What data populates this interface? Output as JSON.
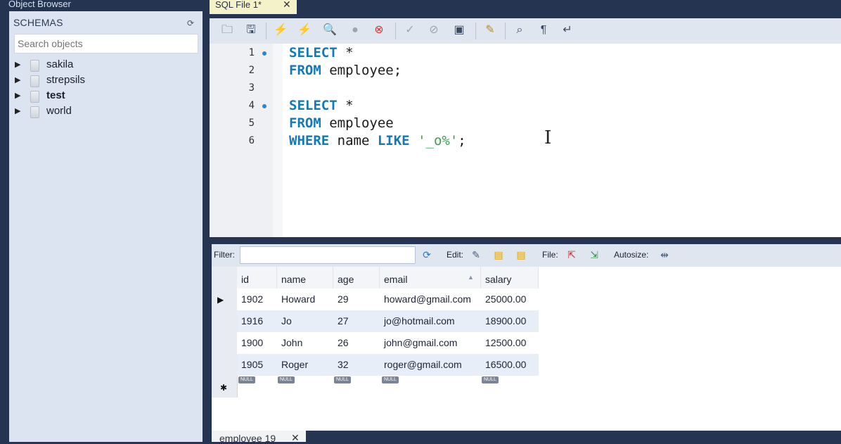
{
  "left_panel": {
    "title": "Object Browser",
    "schemas_header": "SCHEMAS",
    "search_placeholder": "Search objects",
    "schemas": [
      {
        "name": "sakila",
        "bold": false
      },
      {
        "name": "strepsils",
        "bold": false
      },
      {
        "name": "test",
        "bold": true
      },
      {
        "name": "world",
        "bold": false
      }
    ]
  },
  "editor_tab": {
    "label": "SQL File 1*",
    "close": "✕"
  },
  "editor": {
    "lines": [
      {
        "n": "1",
        "dot": true
      },
      {
        "n": "2",
        "dot": false
      },
      {
        "n": "3",
        "dot": false
      },
      {
        "n": "4",
        "dot": true
      },
      {
        "n": "5",
        "dot": false
      },
      {
        "n": "6",
        "dot": false
      }
    ],
    "code": {
      "l1_kw": "SELECT",
      "l1_rest": " *",
      "l2_kw": "FROM",
      "l2_rest": " employee;",
      "l4_kw": "SELECT",
      "l4_rest": " *",
      "l5_kw": "FROM",
      "l5_rest": " employee",
      "l6_kw1": "WHERE",
      "l6_mid": " name ",
      "l6_kw2": "LIKE",
      "l6_sp": " ",
      "l6_str": "'_o%'",
      "l6_end": ";"
    }
  },
  "result_toolbar": {
    "filter_label": "Filter:",
    "edit_label": "Edit:",
    "file_label": "File:",
    "autosize_label": "Autosize:"
  },
  "result_grid": {
    "columns": [
      "id",
      "name",
      "age",
      "email",
      "salary"
    ],
    "rows": [
      [
        "1902",
        "Howard",
        "29",
        "howard@gmail.com",
        "25000.00"
      ],
      [
        "1916",
        "Jo",
        "27",
        "jo@hotmail.com",
        "18900.00"
      ],
      [
        "1900",
        "John",
        "26",
        "john@gmail.com",
        "12500.00"
      ],
      [
        "1905",
        "Roger",
        "32",
        "roger@gmail.com",
        "16500.00"
      ]
    ],
    "null_label": "NULL"
  },
  "bottom_tab": {
    "label": "employee 19",
    "close": "✕"
  },
  "colors": {
    "frame": "#253451",
    "keyword": "#1479b8",
    "string": "#3aa24b",
    "tab_active": "#f3f2c9",
    "row_alt": "#e8eef8"
  }
}
